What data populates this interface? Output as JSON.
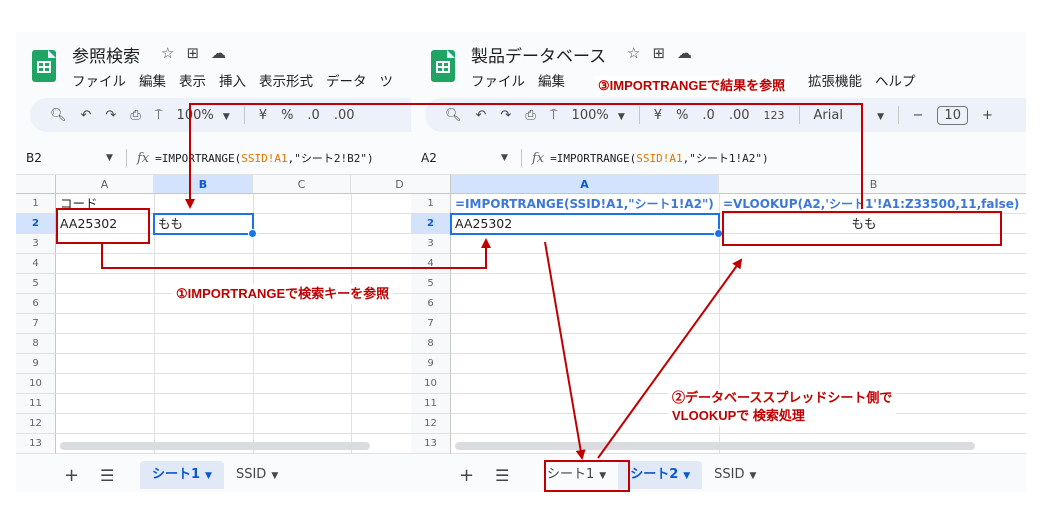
{
  "left": {
    "title": "参照検索",
    "menu": [
      "ファイル",
      "編集",
      "表示",
      "挿入",
      "表示形式",
      "データ",
      "ツ"
    ],
    "zoom": "100%",
    "currency": "¥",
    "percent": "%",
    "dec_less": ".0",
    "dec_more": ".00",
    "namebox": "B2",
    "formula_prefix": "=IMPORTRANGE(",
    "formula_ref": "SSID!A1",
    "formula_suffix": ",\"シート2!B2\")",
    "columns": [
      "A",
      "B",
      "C",
      "D"
    ],
    "rows": [
      "1",
      "2",
      "3",
      "4",
      "5",
      "6",
      "7",
      "8",
      "9",
      "10",
      "11",
      "12",
      "13"
    ],
    "cells": {
      "a1": "コード",
      "a2": "AA25302",
      "b2": "もも"
    },
    "tabs": {
      "sheet1": "シート1",
      "ssid": "SSID"
    }
  },
  "right": {
    "title": "製品データベース",
    "menu": [
      "ファイル",
      "編集",
      "拡張機能",
      "ヘルプ"
    ],
    "zoom": "100%",
    "currency": "¥",
    "percent": "%",
    "dec_less": ".0",
    "dec_more": ".00",
    "num_format": "123",
    "font": "Arial",
    "font_size": "10",
    "minus": "−",
    "plus": "+",
    "namebox": "A2",
    "formula_prefix": "=IMPORTRANGE(",
    "formula_ref": "SSID!A1",
    "formula_suffix": ",\"シート1!A2\")",
    "columns": [
      "A",
      "B"
    ],
    "rows": [
      "1",
      "2",
      "3",
      "4",
      "5",
      "6",
      "7",
      "8",
      "9",
      "10",
      "11",
      "12",
      "13"
    ],
    "cells": {
      "a1": "=IMPORTRANGE(SSID!A1,\"シート1!A2\")",
      "b1": "=VLOOKUP(A2,'シート1'!A1:Z33500,11,false)",
      "a2": "AA25302",
      "b2": "もも"
    },
    "tabs": {
      "sheet1": "シート1",
      "sheet2": "シート2",
      "ssid": "SSID"
    }
  },
  "annotations": {
    "step1": "①IMPORTRANGEで検索キーを参照",
    "step2_line1": "②データベーススプレッドシート側で",
    "step2_line2": "VLOOKUPで 検索処理",
    "step3": "③IMPORTRANGEで結果を参照"
  },
  "colors": {
    "annotation_red": "#c00000",
    "selection_blue": "#1a73e8",
    "formula_blue": "#3c78d8",
    "sheets_green": "#1fa463"
  }
}
